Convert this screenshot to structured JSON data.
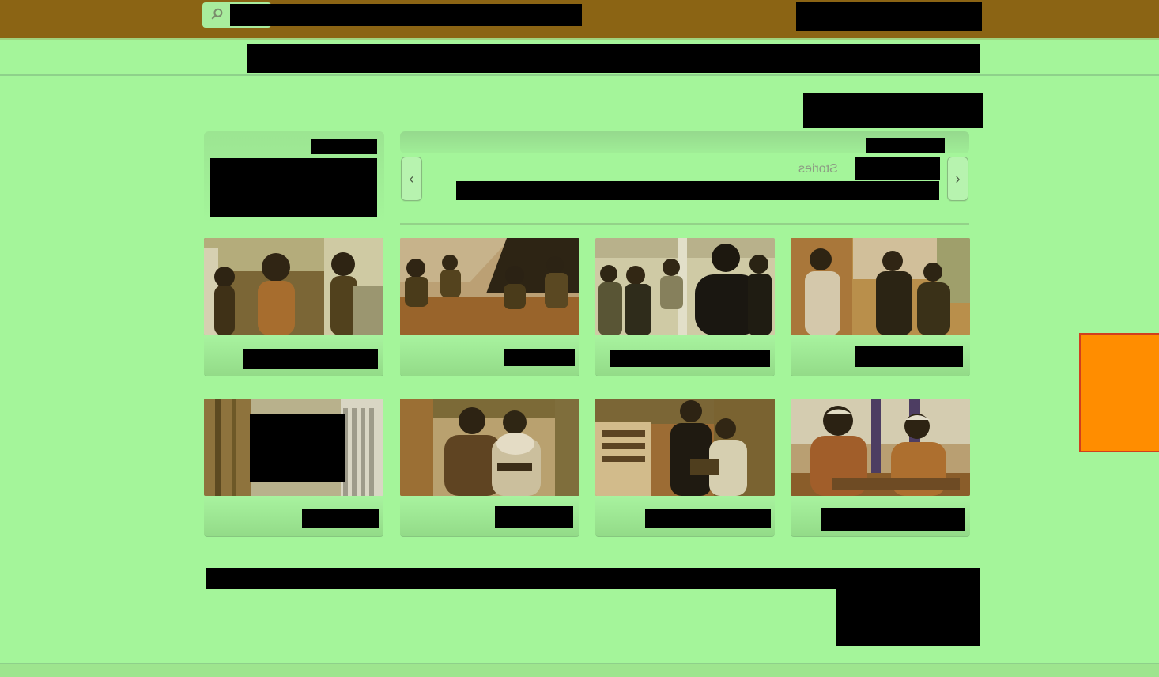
{
  "header": {
    "search_query": "████████████████████",
    "top_right_link": "██████████",
    "nav_bar": "███████████████████████████████████████████████████"
  },
  "main": {
    "page_heading": "██████████",
    "left_panel": {
      "label": "████",
      "content": "████████████"
    },
    "carousel": {
      "header_label": "█████",
      "section_label": "Stories",
      "section_title": "█████",
      "description": "████████████████████████████████████",
      "prev_label": "‹",
      "next_label": "›"
    },
    "cards": [
      {
        "caption": "████████",
        "icon": "people-image"
      },
      {
        "caption": "█████",
        "icon": "people-image"
      },
      {
        "caption": "█████████",
        "icon": "people-image"
      },
      {
        "caption": "███████",
        "icon": "people-image"
      },
      {
        "caption": "████",
        "icon": "building-image"
      },
      {
        "caption": "████",
        "icon": "people-image"
      },
      {
        "caption": "████████",
        "icon": "people-image"
      },
      {
        "caption": "████████",
        "icon": "people-image"
      }
    ],
    "footer_text": "██████████████████████████████████████████████████████████",
    "footer_block": "███████"
  },
  "colors": {
    "background": "#a4f59a",
    "topbar": "#8b6414",
    "accent": "#ff8d00"
  }
}
